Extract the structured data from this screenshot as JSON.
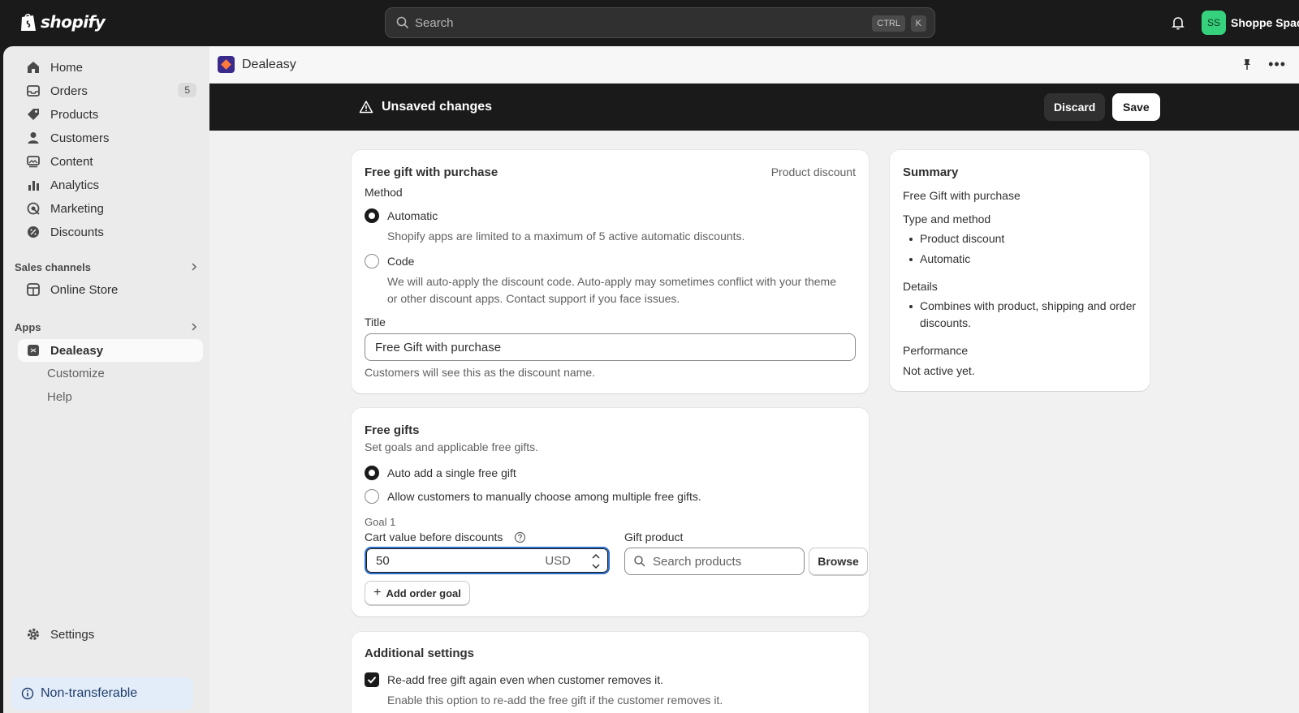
{
  "topbar": {
    "logo_text": "shopify",
    "search_placeholder": "Search",
    "shortcut_ctrl": "CTRL",
    "shortcut_key": "K",
    "store_initials": "SS",
    "store_name": "Shoppe Space"
  },
  "sidebar": {
    "items": [
      {
        "label": "Home",
        "icon": "home-icon"
      },
      {
        "label": "Orders",
        "icon": "orders-icon",
        "badge": "5"
      },
      {
        "label": "Products",
        "icon": "tag-icon"
      },
      {
        "label": "Customers",
        "icon": "person-icon"
      },
      {
        "label": "Content",
        "icon": "content-icon"
      },
      {
        "label": "Analytics",
        "icon": "bar-chart-icon"
      },
      {
        "label": "Marketing",
        "icon": "target-icon"
      },
      {
        "label": "Discounts",
        "icon": "discount-icon"
      }
    ],
    "sales_channels_label": "Sales channels",
    "online_store_label": "Online Store",
    "apps_label": "Apps",
    "app_active_label": "Dealeasy",
    "app_sub_items": [
      "Customize",
      "Help"
    ],
    "settings_label": "Settings",
    "footer_note": "Non-transferable"
  },
  "app_header": {
    "title": "Dealeasy"
  },
  "save_bar": {
    "message": "Unsaved changes",
    "discard_label": "Discard",
    "save_label": "Save"
  },
  "discount_card": {
    "title": "Free gift with purchase",
    "type_label": "Product discount",
    "method_label": "Method",
    "automatic_label": "Automatic",
    "automatic_help": "Shopify apps are limited to a maximum of 5 active automatic discounts.",
    "code_label": "Code",
    "code_help_1": "We will auto-apply the discount code. Auto-apply may sometimes conflict with your theme",
    "code_help_2": "or other discount apps. Contact support if you face issues.",
    "title_label": "Title",
    "title_value": "Free Gift with purchase",
    "title_help": "Customers will see this as the discount name."
  },
  "gifts_card": {
    "title": "Free gifts",
    "subtitle": "Set goals and applicable free gifts.",
    "option_auto": "Auto add a single free gift",
    "option_manual": "Allow customers to manually choose among multiple free gifts.",
    "goal_label": "Goal 1",
    "cart_value_label": "Cart value before discounts",
    "cart_value": "50",
    "currency": "USD",
    "gift_product_label": "Gift product",
    "search_products_placeholder": "Search products",
    "browse_label": "Browse",
    "add_goal_label": "Add order goal"
  },
  "additional_card": {
    "title": "Additional settings",
    "readd_label": "Re-add free gift again even when customer removes it.",
    "readd_help": "Enable this option to re-add the free gift if the customer removes it."
  },
  "summary": {
    "title": "Summary",
    "name": "Free Gift with purchase",
    "type_heading": "Type and method",
    "type_items": [
      "Product discount",
      "Automatic"
    ],
    "details_heading": "Details",
    "details_items": [
      "Combines with product, shipping and order discounts."
    ],
    "performance_heading": "Performance",
    "performance_value": "Not active yet."
  }
}
